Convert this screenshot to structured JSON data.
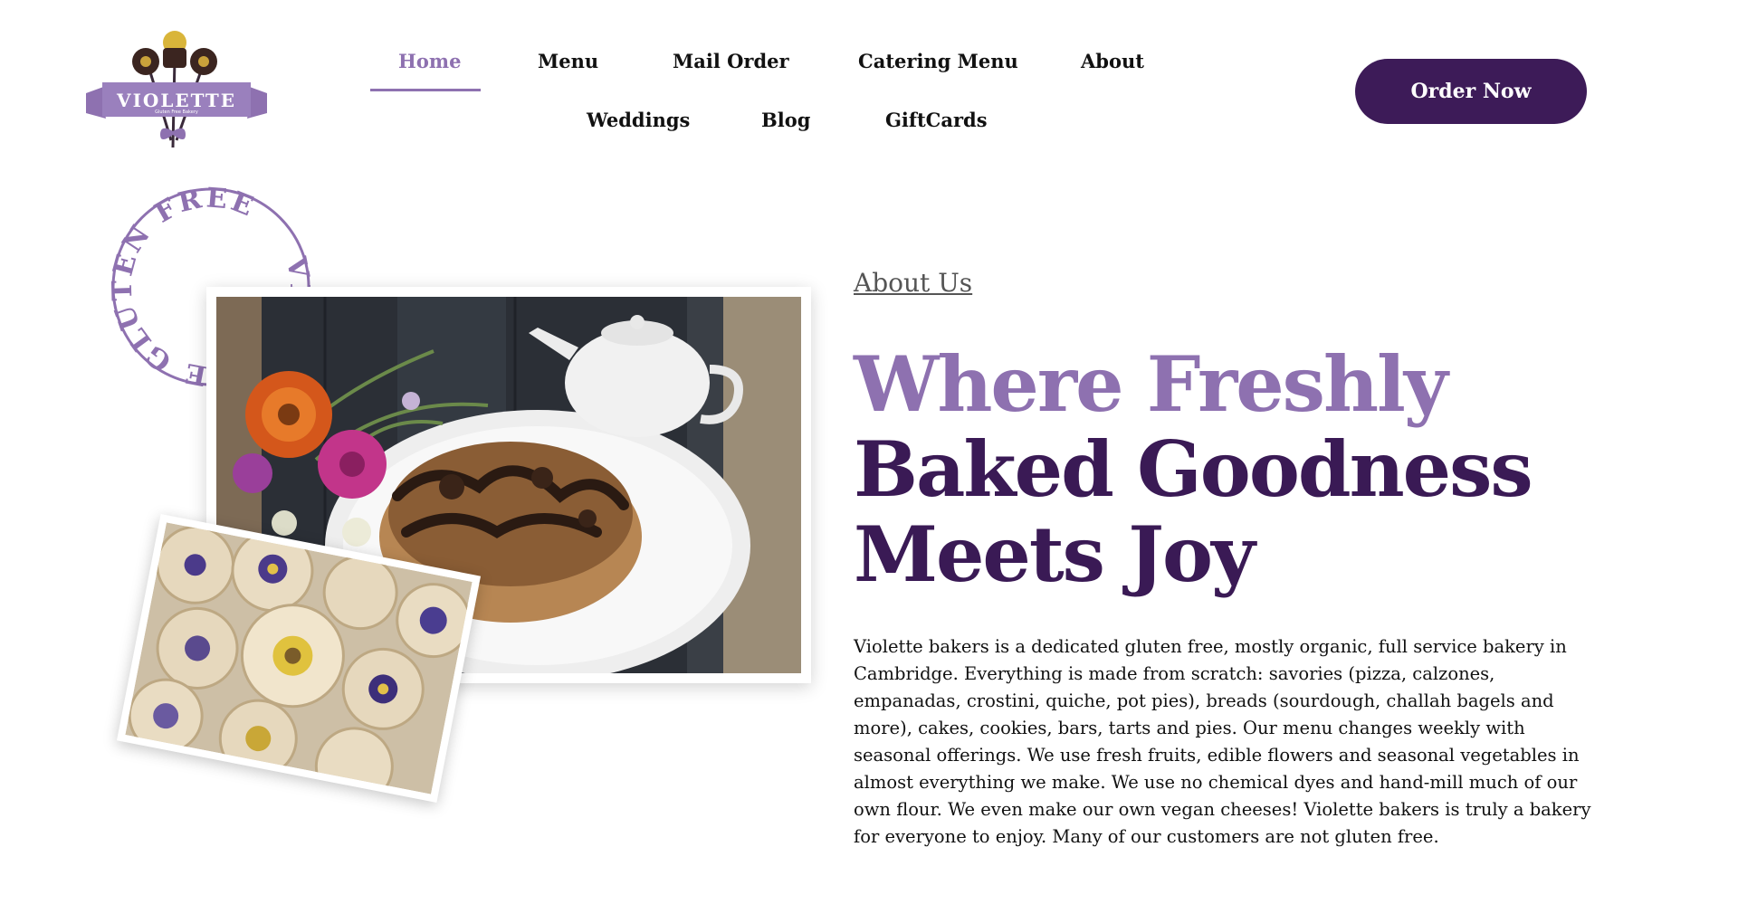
{
  "brand": {
    "name": "VIOLETTE",
    "tagline": "Gluten Free Bakery"
  },
  "nav": {
    "items": [
      {
        "label": "Home",
        "active": true
      },
      {
        "label": "Menu"
      },
      {
        "label": "Mail Order"
      },
      {
        "label": "Catering Menu"
      },
      {
        "label": "About"
      },
      {
        "label": "Weddings"
      },
      {
        "label": "Blog"
      },
      {
        "label": "GiftCards"
      }
    ],
    "cta": "Order Now"
  },
  "stamp": {
    "text": "VIOLETTE GLUTEN FREE"
  },
  "hero": {
    "section_label": "About Us",
    "headline_line1": "Where Freshly",
    "headline_line2": "Baked Goodness",
    "headline_line3": "Meets Joy",
    "body": "Violette bakers is a dedicated gluten free, mostly organic, full service bakery in Cambridge. Everything is made from scratch: savories (pizza, calzones, empanadas, crostini, quiche, pot pies), breads (sourdough, challah bagels and more), cakes, cookies, bars, tarts and pies. Our menu changes weekly with seasonal offerings. We use fresh fruits, edible flowers and seasonal vegetables in almost everything we make. We use no chemical dyes and hand-mill much of our own flour. We even make our own vegan cheeses! Violette bakers is truly a bakery for everyone to enjoy. Many of our customers are not gluten free."
  },
  "colors": {
    "accent": "#8e71b0",
    "brand_dark": "#3d1b58",
    "headline_dark": "#3a1a55"
  }
}
